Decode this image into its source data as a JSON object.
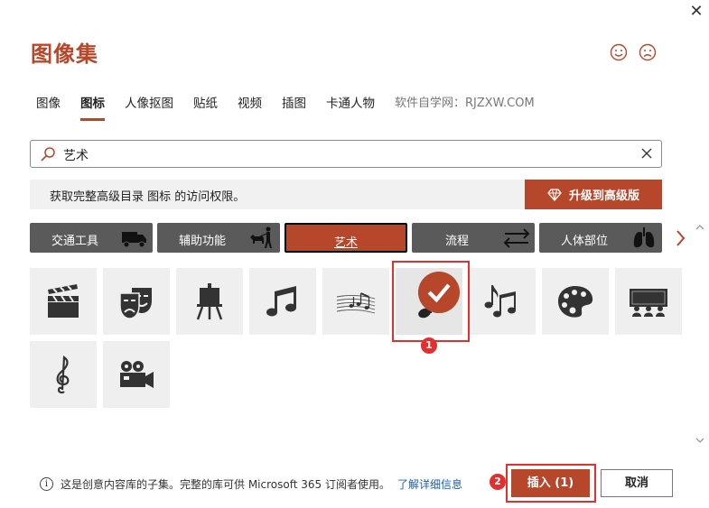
{
  "dialog": {
    "title": "图像集",
    "close_glyph": "✕"
  },
  "tabs": [
    {
      "label": "图像",
      "active": false
    },
    {
      "label": "图标",
      "active": true
    },
    {
      "label": "人像抠图",
      "active": false
    },
    {
      "label": "贴纸",
      "active": false
    },
    {
      "label": "视频",
      "active": false
    },
    {
      "label": "插图",
      "active": false
    },
    {
      "label": "卡通人物",
      "active": false
    }
  ],
  "watermark": "软件自学网：RJZXW.COM",
  "search": {
    "value": "艺术",
    "icon": "search-icon"
  },
  "upsell": {
    "message": "获取完整高级目录 图标 的访问权限。",
    "button_label": "升级到高级版",
    "button_icon": "diamond-icon"
  },
  "categories": [
    {
      "label": "交通工具",
      "icon": "truck-icon",
      "active": false
    },
    {
      "label": "辅助功能",
      "icon": "guide-dog-icon",
      "active": false
    },
    {
      "label": "艺术",
      "icon": "",
      "active": true
    },
    {
      "label": "流程",
      "icon": "swap-arrows-icon",
      "active": false
    },
    {
      "label": "人体部位",
      "icon": "lungs-icon",
      "active": false
    }
  ],
  "icons": [
    {
      "name": "clapperboard-icon",
      "selected": false
    },
    {
      "name": "theater-masks-icon",
      "selected": false
    },
    {
      "name": "easel-icon",
      "selected": false
    },
    {
      "name": "beamed-notes-icon",
      "selected": false
    },
    {
      "name": "sheet-music-icon",
      "selected": false
    },
    {
      "name": "eighth-note-icon",
      "selected": true
    },
    {
      "name": "music-notes-icon",
      "selected": false
    },
    {
      "name": "palette-icon",
      "selected": false
    },
    {
      "name": "theater-audience-icon",
      "selected": false
    },
    {
      "name": "treble-clef-icon",
      "selected": false
    },
    {
      "name": "movie-camera-icon",
      "selected": false
    }
  ],
  "annotations": [
    "1",
    "2"
  ],
  "footer": {
    "info_text": "这是创意内容库的子集。完整的库可供 Microsoft 365 订阅者使用。",
    "link_text": "了解详细信息",
    "insert_label": "插入 (1)",
    "cancel_label": "取消"
  },
  "colors": {
    "accent": "#b7472a",
    "category_bg": "#5a5a5a",
    "annotation": "#e3302f",
    "tile_bg": "#efefef"
  }
}
